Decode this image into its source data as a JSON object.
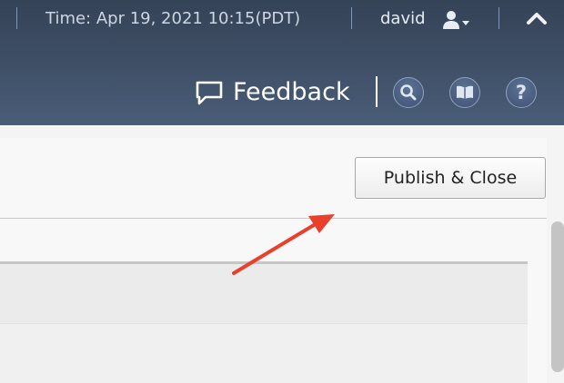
{
  "header": {
    "time_text": "Time: Apr 19, 2021 10:15(PDT)",
    "user_name": "david",
    "feedback_label": "Feedback",
    "icons": {
      "user_menu": "user-dropdown-icon",
      "collapse": "chevron-up-icon",
      "feedback": "speech-bubble-icon",
      "search": "search-icon",
      "guide": "book-icon",
      "help": "help-icon"
    }
  },
  "help_glyph": "?",
  "toolbar": {
    "publish_close_label": "Publish & Close"
  },
  "colors": {
    "header_bg": "#3c4c62",
    "annotation_arrow": "#e8402a"
  }
}
